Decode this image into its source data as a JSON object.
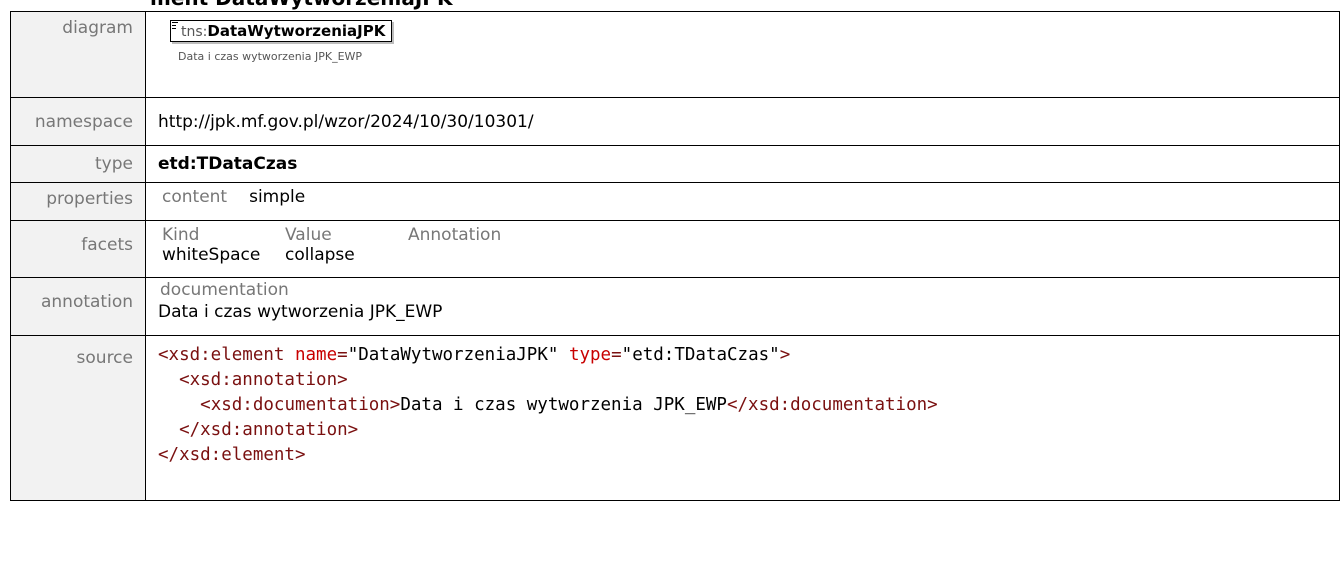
{
  "header_fragment": "ment  DataWytworzeniaJPK",
  "labels": {
    "diagram": "diagram",
    "namespace": "namespace",
    "type": "type",
    "properties": "properties",
    "facets": "facets",
    "annotation": "annotation",
    "source": "source"
  },
  "diagram": {
    "prefix": "tns:",
    "element_name": "DataWytworzeniaJPK",
    "note": "Data i czas wytworzenia JPK_EWP"
  },
  "namespace": "http://jpk.mf.gov.pl/wzor/2024/10/30/10301/",
  "type": "etd:TDataCzas",
  "properties": {
    "key": "content",
    "value": "simple"
  },
  "facets": {
    "headers": [
      "Kind",
      "Value",
      "Annotation"
    ],
    "rows": [
      {
        "kind": "whiteSpace",
        "value": "collapse",
        "annotation": ""
      }
    ]
  },
  "annotation": {
    "head": "documentation",
    "text": "Data i czas wytworzenia JPK_EWP"
  },
  "source": {
    "l1_open": "<xsd:element",
    "l1_attr1": "name",
    "l1_eq1": "=",
    "l1_val1": "\"DataWytworzeniaJPK\"",
    "l1_attr2": "type",
    "l1_eq2": "=",
    "l1_val2": "\"etd:TDataCzas\"",
    "l1_close": ">",
    "l2": "<xsd:annotation>",
    "l3_open": "<xsd:documentation>",
    "l3_text": "Data i czas wytworzenia JPK_EWP",
    "l3_close": "</xsd:documentation>",
    "l4": "</xsd:annotation>",
    "l5": "</xsd:element>"
  }
}
